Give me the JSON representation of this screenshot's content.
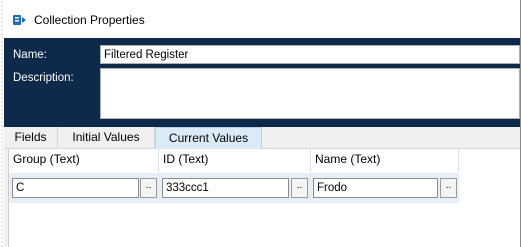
{
  "window": {
    "title": "Collection Properties",
    "icon": "collection-icon"
  },
  "header": {
    "name_label": "Name:",
    "name_value": "Filtered Register",
    "description_label": "Description:",
    "description_value": ""
  },
  "tabs": [
    {
      "label": "Fields"
    },
    {
      "label": "Initial Values"
    },
    {
      "label": "Current Values",
      "active": true
    }
  ],
  "grid": {
    "columns": [
      {
        "label": "Group  (Text)"
      },
      {
        "label": "ID  (Text)"
      },
      {
        "label": "Name  (Text)"
      }
    ],
    "rows": [
      {
        "cells": [
          "C",
          "333ccc1",
          "Frodo"
        ]
      }
    ],
    "ellipsis_label": ".."
  },
  "colors": {
    "header_bg": "#0e2a4a",
    "active_tab_bg": "#dbeaf7",
    "row_bg": "#e6eef8"
  }
}
